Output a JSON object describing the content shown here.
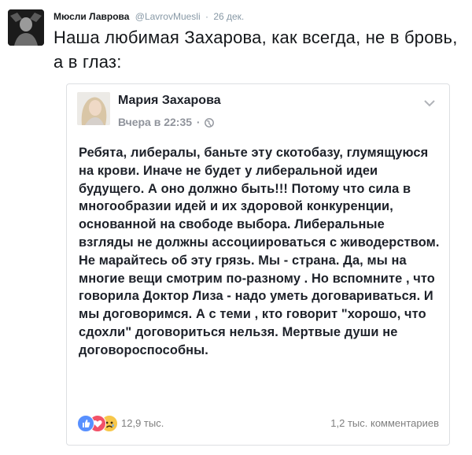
{
  "tweet": {
    "author_name": "Мюсли Лаврова",
    "author_handle": "@LavrovMuesli",
    "dot": "·",
    "date": "26 дек.",
    "text": "Наша любимая Захарова, как всегда, не в бровь, а в глаз:"
  },
  "fb_card": {
    "author_name": "Мария Захарова",
    "time": "Вчера в 22:35",
    "dot": "·",
    "post_text": "Ребята, либералы, баньте эту скотобазу, глумящуюся на крови. Иначе не будет у либеральной идеи будущего. А оно должно быть!!!  Потому что сила в многообразии идей и их здоровой конкуренции, основанной  на свободе выбора. Либеральные  взгляды  не должны ассоциироваться с живодерством. Не марайтесь об эту грязь. Мы - страна. Да, мы на многие вещи смотрим по-разному . Но вспомните , что говорила Доктор Лиза - надо уметь  договариваться. И мы договоримся. А с теми , кто говорит \"хорошо, что сдохли\" договориться нельзя. Мертвые души не договороспособны.",
    "reactions_count": "12,9 тыс.",
    "comments_count": "1,2 тыс. комментариев",
    "reaction_icons": [
      "like-reaction-icon",
      "love-reaction-icon",
      "sad-reaction-icon"
    ]
  },
  "colors": {
    "tweet_text": "#14171a",
    "muted": "#8899a6",
    "card_border": "#dddfe2",
    "fb_text": "#1d2129",
    "fb_meta": "#90949c",
    "like_blue": "#5890ff",
    "love_red": "#f25268",
    "sad_yellow": "#f7c74a"
  }
}
